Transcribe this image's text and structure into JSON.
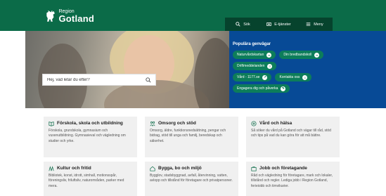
{
  "header": {
    "logo_region": "Region",
    "logo_gotland": "Gotland",
    "nav": [
      {
        "label": "Sök",
        "icon": "search-icon"
      },
      {
        "label": "E-tjänster",
        "icon": "eservice-icon"
      },
      {
        "label": "Meny",
        "icon": "menu-icon"
      }
    ]
  },
  "search": {
    "placeholder": "Hej, vad letar du efter?"
  },
  "shortcuts": {
    "title": "Populära genvägar",
    "items": [
      {
        "label": "Naturvårdskartan",
        "icon": "link-icon"
      },
      {
        "label": "Din bredbandskoll",
        "icon": "link-icon"
      },
      {
        "label": "Driftmeddelanden",
        "icon": "alert-icon"
      },
      {
        "label": "Vård - 1177.se",
        "icon": "external-icon"
      },
      {
        "label": "Kontakta oss",
        "icon": "people-icon"
      },
      {
        "label": "Engagera dig och påverka",
        "icon": "pen-icon"
      }
    ]
  },
  "cards": [
    {
      "title": "Förskola, skola och utbildning",
      "text": "Förskola, grundskola, gymnasium och vuxenutbildning. Gymnasieval och vägledning om studier och yrke."
    },
    {
      "title": "Omsorg och stöd",
      "text": "Omsorg, äldre, funktionsnedsättning, pengar och bidrag, stöd till unga och familj, beredskap och säkerhet."
    },
    {
      "title": "Vård och hälsa",
      "text": "Så söker du vård på Gotland och vägar till råd, stöd och tips på vad du kan göra för att må bättre."
    },
    {
      "title": "Kultur och fritid",
      "text": "Bibliotek, konst, idrott, simhall, motionsspår, föreningsliv, friluftsliv, naturområden, parker med mera."
    },
    {
      "title": "Bygga, bo och miljö",
      "text": "Bygglov, stadsbyggnad, avfall, återvinning, vatten, avlopp och tillstånd för företagare och privatpersoner."
    },
    {
      "title": "Jobb och företagande",
      "text": "Råd och vägledning för företagare, mark och lokaler, tillstånd och regler. Lediga jobb i Region Gotland, ferieiobb och timvikarier."
    }
  ],
  "colors": {
    "header_green": "#0b6b48",
    "nav_dark": "#06432d",
    "shortcut_blue": "#074a96",
    "pill_green": "#0d7d5a"
  }
}
